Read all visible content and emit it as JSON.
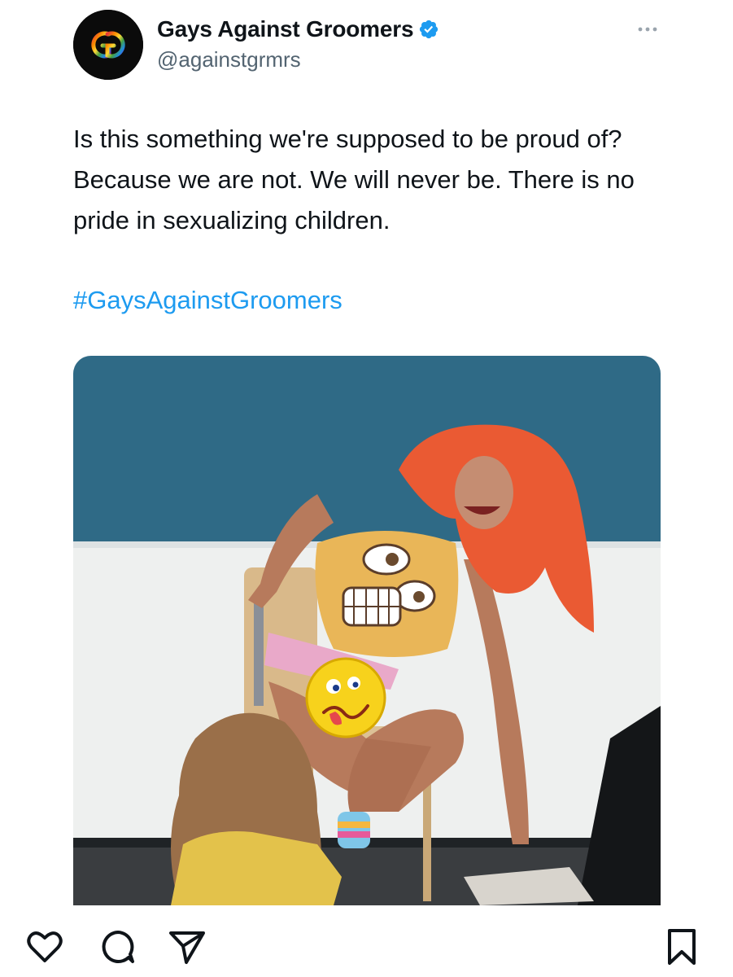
{
  "post": {
    "author": {
      "display_name": "Gays Against Groomers",
      "handle": "@againstgrmrs",
      "verified": true,
      "avatar_icon": "gg-logo-icon"
    },
    "text": "Is this something we're supposed to be proud of? Because we are not. We will never be. There is no pride in sexualizing children.",
    "hashtag": "#GaysAgainstGroomers",
    "menu_icon": "more-dots-icon"
  },
  "actions": {
    "like_icon": "heart-icon",
    "comment_icon": "comment-icon",
    "share_icon": "send-icon",
    "save_icon": "bookmark-icon"
  },
  "colors": {
    "hashtag": "#1d9bf0",
    "verified": "#1d9bf0",
    "handle": "#536471",
    "text": "#0f1419"
  }
}
